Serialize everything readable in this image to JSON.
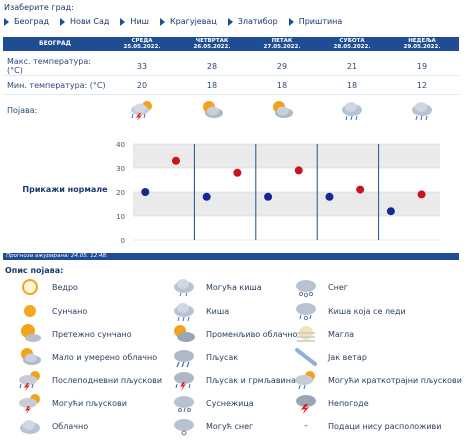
{
  "select_label": "Изаберите град:",
  "cities": [
    "Београд",
    "Нови Сад",
    "Ниш",
    "Крагујевац",
    "Златибор",
    "Приштина"
  ],
  "table": {
    "header_first": "БЕОГРАД",
    "days": [
      {
        "name": "СРЕДА",
        "date": "25.05.2022."
      },
      {
        "name": "ЧЕТВРТАК",
        "date": "26.05.2022."
      },
      {
        "name": "ПЕТАК",
        "date": "27.05.2022."
      },
      {
        "name": "СУБОТА",
        "date": "28.05.2022."
      },
      {
        "name": "НЕДЕЉА",
        "date": "29.05.2022."
      }
    ],
    "max_label": "Макс. температура: (°C)",
    "min_label": "Мин. температура: (°C)",
    "phen_label": "Појава:",
    "max": [
      "33",
      "28",
      "29",
      "21",
      "19"
    ],
    "min": [
      "20",
      "18",
      "18",
      "18",
      "12"
    ],
    "phen_icons": [
      "storm-sun-icon",
      "partly-cloudy-icon",
      "partly-cloudy-icon",
      "rain-icon",
      "rain-icon"
    ]
  },
  "show_normals": "Прикажи нормале",
  "chart_data": {
    "type": "scatter",
    "categories": [
      "СРЕДА",
      "ЧЕТВРТАК",
      "ПЕТАК",
      "СУБОТА",
      "НЕДЕЉА"
    ],
    "series": [
      {
        "values": [
          33,
          28,
          29,
          21,
          19
        ],
        "color": "#c8141e"
      },
      {
        "values": [
          20,
          18,
          18,
          18,
          12
        ],
        "color": "#14289a"
      }
    ],
    "ylim": [
      0,
      40
    ],
    "yticks": [
      "0",
      "10",
      "20",
      "30",
      "40"
    ],
    "grid": true
  },
  "forecast_updated": "Прогноза ажурирана:  24.05. 12:48.",
  "legend_title": "Опис појава:",
  "legend": [
    {
      "icon": "sun-outline-icon",
      "label": "Ведро"
    },
    {
      "icon": "sun-icon",
      "label": "Сунчано"
    },
    {
      "icon": "mostly-sunny-icon",
      "label": "Претежно сунчано"
    },
    {
      "icon": "partly-cloudy-icon",
      "label": "Мало и умерено облачно"
    },
    {
      "icon": "afternoon-showers-icon",
      "label": "Послеподневни пљускови"
    },
    {
      "icon": "possible-showers-icon",
      "label": "Могући пљускови"
    },
    {
      "icon": "cloudy-icon",
      "label": "Облачно"
    },
    {
      "icon": "possible-rain-icon",
      "label": "Могућа киша"
    },
    {
      "icon": "rain-icon",
      "label": "Киша"
    },
    {
      "icon": "variable-cloudy-icon",
      "label": "Променљиво облачно"
    },
    {
      "icon": "shower-icon",
      "label": "Пљусак"
    },
    {
      "icon": "thunder-shower-icon",
      "label": "Пљусак и грмљавина"
    },
    {
      "icon": "sleet-icon",
      "label": "Суснежица"
    },
    {
      "icon": "possible-snow-icon",
      "label": "Могућ снег"
    },
    {
      "icon": "snow-icon",
      "label": "Снег"
    },
    {
      "icon": "freezing-rain-icon",
      "label": "Киша која се леди"
    },
    {
      "icon": "fog-icon",
      "label": "Магла"
    },
    {
      "icon": "strong-wind-icon",
      "label": "Јак ветар"
    },
    {
      "icon": "short-showers-icon",
      "label": "Могући краткотрајни пљускови"
    },
    {
      "icon": "storm-icon",
      "label": "Непогоде"
    },
    {
      "icon": "no-data-dash",
      "label": "-"
    },
    {
      "icon": "no-data-icon",
      "label": "Подаци нису расположиви"
    }
  ]
}
